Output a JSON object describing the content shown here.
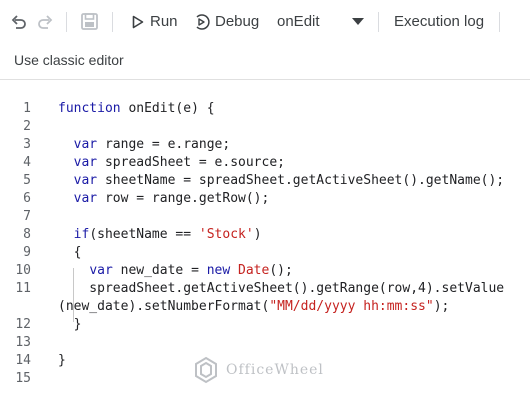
{
  "toolbar": {
    "undo_icon": "undo-icon",
    "redo_icon": "redo-icon",
    "save_icon": "save-icon",
    "run_label": "Run",
    "debug_label": "Debug",
    "function_select_value": "onEdit",
    "execution_log_label": "Execution log"
  },
  "classic_editor_link": "Use classic editor",
  "editor": {
    "line_numbers": [
      "1",
      "2",
      "3",
      "4",
      "5",
      "6",
      "7",
      "8",
      "9",
      "10",
      "11",
      "",
      "12",
      "13",
      "14",
      "15"
    ],
    "lines": [
      "function onEdit(e) {",
      "",
      "  var range = e.range;",
      "  var spreadSheet = e.source;",
      "  var sheetName = spreadSheet.getActiveSheet().getName();",
      "  var row = range.getRow();",
      "",
      "  if(sheetName == 'Stock')",
      "  {",
      "    var new_date = new Date();",
      "    spreadSheet.getActiveSheet().getRange(row,4).setValue",
      "(new_date).setNumberFormat(\"MM/dd/yyyy hh:mm:ss\");",
      "  }",
      "",
      "}",
      ""
    ]
  },
  "watermark": "OfficeWheel",
  "colors": {
    "keyword": "#1a1aa6",
    "string": "#c5221f",
    "text": "#202124"
  }
}
